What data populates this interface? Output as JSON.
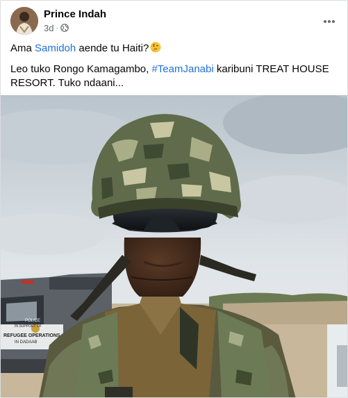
{
  "post": {
    "author": "Prince Indah",
    "time": "3d",
    "separator": "·",
    "privacy_icon": "globe-icon",
    "more_icon": "more-dots-icon",
    "text_line1_before": "Ama ",
    "mention": "Samidoh",
    "text_line1_after": " aende tu Haiti?",
    "emoji_icon": "thinking-face-emoji",
    "text_line2_before": "Leo tuko Rongo Kamagambo, ",
    "hashtag": "#TeamJanabi",
    "text_line2_after": " karibuni TREAT HOUSE",
    "text_line3": "RESORT. Tuko ndaani..."
  },
  "photo": {
    "vehicle_sign": [
      "POLICE",
      "IN SUPPORT OF",
      "REFUGEE OPERATIONS",
      "IN DADAAB"
    ]
  },
  "colors": {
    "link": "#216fdb",
    "secondary_text": "#65676b",
    "sky": "#c9d2d9",
    "helmet_camo": "#5f6b4a"
  }
}
